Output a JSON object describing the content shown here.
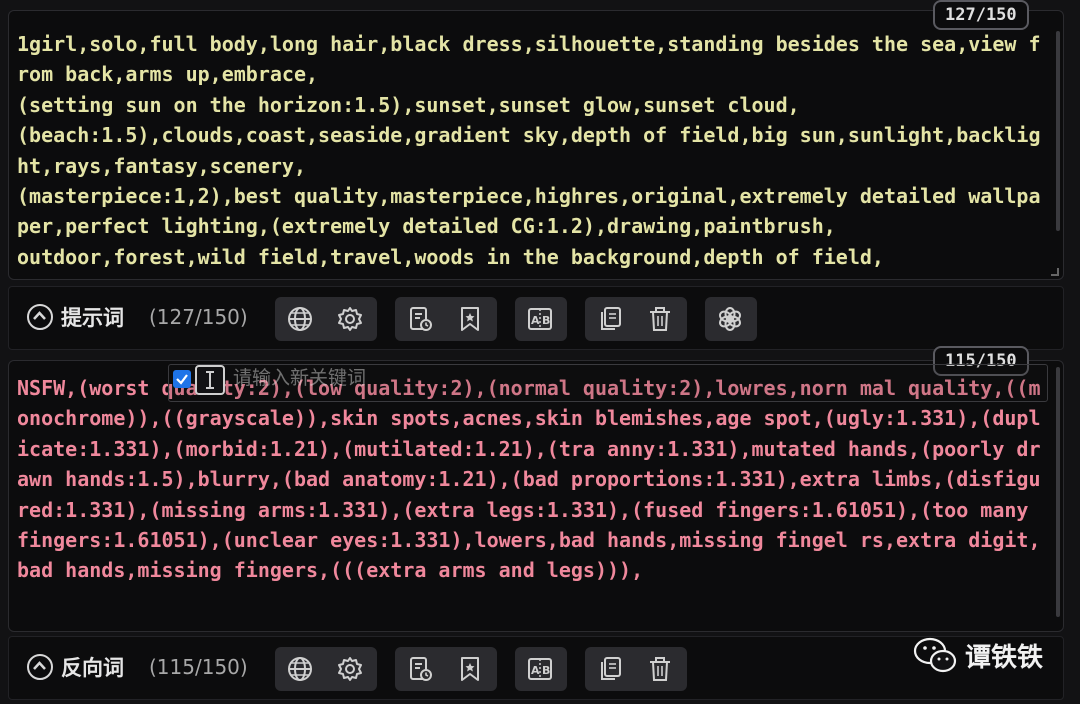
{
  "positive": {
    "text": "1girl,solo,full body,long hair,black dress,silhouette,standing besides the sea,view from back,arms up,embrace,\n(setting sun on the horizon:1.5),sunset,sunset glow,sunset cloud,\n(beach:1.5),clouds,coast,seaside,gradient sky,depth of field,big sun,sunlight,backlight,rays,fantasy,scenery,\n(masterpiece:1,2),best quality,masterpiece,highres,original,extremely detailed wallpaper,perfect lighting,(extremely detailed CG:1.2),drawing,paintbrush,\noutdoor,forest,wild field,travel,woods in the background,depth of field,",
    "counter": "127/150",
    "toolbar_label": "提示词",
    "toolbar_count": "(127/150)"
  },
  "negative": {
    "text": "NSFW,(worst quality:2),(low quality:2),(normal quality:2),lowres,norn mal quality,((monochrome)),((grayscale)),skin spots,acnes,skin blemishes,age spot,(ugly:1.331),(duplicate:1.331),(morbid:1.21),(mutilated:1.21),(tra anny:1.331),mutated hands,(poorly drawn hands:1.5),blurry,(bad anatomy:1.21),(bad proportions:1.331),extra limbs,(disfigured:1.331),(missing arms:1.331),(extra legs:1.331),(fused fingers:1.61051),(too many fingers:1.61051),(unclear eyes:1.331),lowers,bad hands,missing fingel rs,extra digit,bad hands,missing fingers,(((extra arms and legs))),",
    "counter": "115/150",
    "toolbar_label": "反向词",
    "toolbar_count": "(115/150)"
  },
  "keyword_input": {
    "placeholder": "请输入新关键词"
  },
  "watermark": {
    "name": "谭铁铁",
    "icon": "wechat-icon"
  },
  "toolbar_icons": [
    "globe-icon",
    "gear-icon",
    "history-icon",
    "bookmark-icon",
    "translate-icon",
    "copy-icon",
    "trash-icon",
    "openai-icon"
  ],
  "colors": {
    "positive_text": "#e4e4a6",
    "negative_text": "#f0889c",
    "background": "#0c0c0d",
    "checkbox": "#1e74e8"
  }
}
